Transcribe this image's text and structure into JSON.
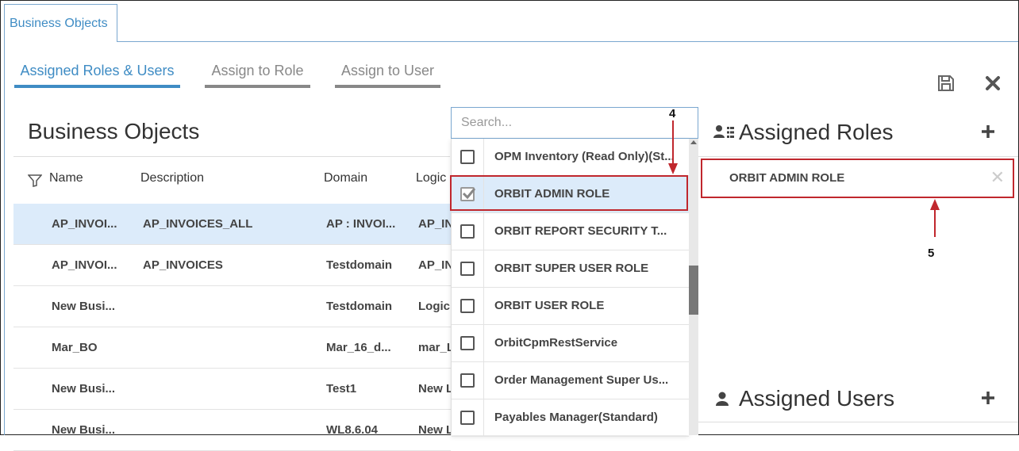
{
  "top_tab": {
    "label": "Business Objects"
  },
  "subtabs": [
    {
      "label": "Assigned Roles & Users",
      "active": true
    },
    {
      "label": "Assign to Role",
      "active": false
    },
    {
      "label": "Assign to User",
      "active": false
    }
  ],
  "toolbar": {
    "save_icon": "save-icon",
    "close_icon": "close-icon"
  },
  "left_panel": {
    "title": "Business Objects",
    "columns": [
      "Name",
      "Description",
      "Domain",
      "Logic"
    ],
    "filter_icon": "filter-icon",
    "rows": [
      {
        "name": "AP_INVOI...",
        "description": "AP_INVOICES_ALL",
        "domain": "AP : INVOI...",
        "logic": "AP_IN",
        "selected": true
      },
      {
        "name": "AP_INVOI...",
        "description": "AP_INVOICES",
        "domain": "Testdomain",
        "logic": "AP_IN",
        "selected": false
      },
      {
        "name": "New Busi...",
        "description": "",
        "domain": "Testdomain",
        "logic": "Logic",
        "selected": false
      },
      {
        "name": "Mar_BO",
        "description": "",
        "domain": "Mar_16_d...",
        "logic": "mar_L",
        "selected": false
      },
      {
        "name": "New Busi...",
        "description": "",
        "domain": "Test1",
        "logic": "New L",
        "selected": false
      },
      {
        "name": "New Busi...",
        "description": "",
        "domain": "WL8.6.04",
        "logic": "New L",
        "selected": false
      }
    ]
  },
  "dropdown": {
    "search_placeholder": "Search...",
    "items": [
      {
        "label": "OPM Inventory (Read Only)(St...",
        "checked": false
      },
      {
        "label": "ORBIT ADMIN ROLE",
        "checked": true
      },
      {
        "label": "ORBIT REPORT SECURITY T...",
        "checked": false
      },
      {
        "label": "ORBIT SUPER USER ROLE",
        "checked": false
      },
      {
        "label": "ORBIT USER ROLE",
        "checked": false
      },
      {
        "label": "OrbitCpmRestService",
        "checked": false
      },
      {
        "label": "Order Management Super Us...",
        "checked": false
      },
      {
        "label": "Payables Manager(Standard)",
        "checked": false
      }
    ]
  },
  "assigned_roles": {
    "title": "Assigned Roles",
    "icon": "user-roles-icon",
    "add_icon": "plus-icon",
    "items": [
      {
        "label": "ORBIT ADMIN ROLE",
        "remove_icon": "remove-x-icon"
      }
    ]
  },
  "assigned_users": {
    "title": "Assigned Users",
    "icon": "user-icon",
    "add_icon": "plus-icon"
  },
  "annotations": {
    "step4": "4",
    "step5": "5"
  },
  "colors": {
    "accent": "#3f8cc4",
    "highlight": "#c0272d",
    "selected_row": "#dcebfa"
  }
}
